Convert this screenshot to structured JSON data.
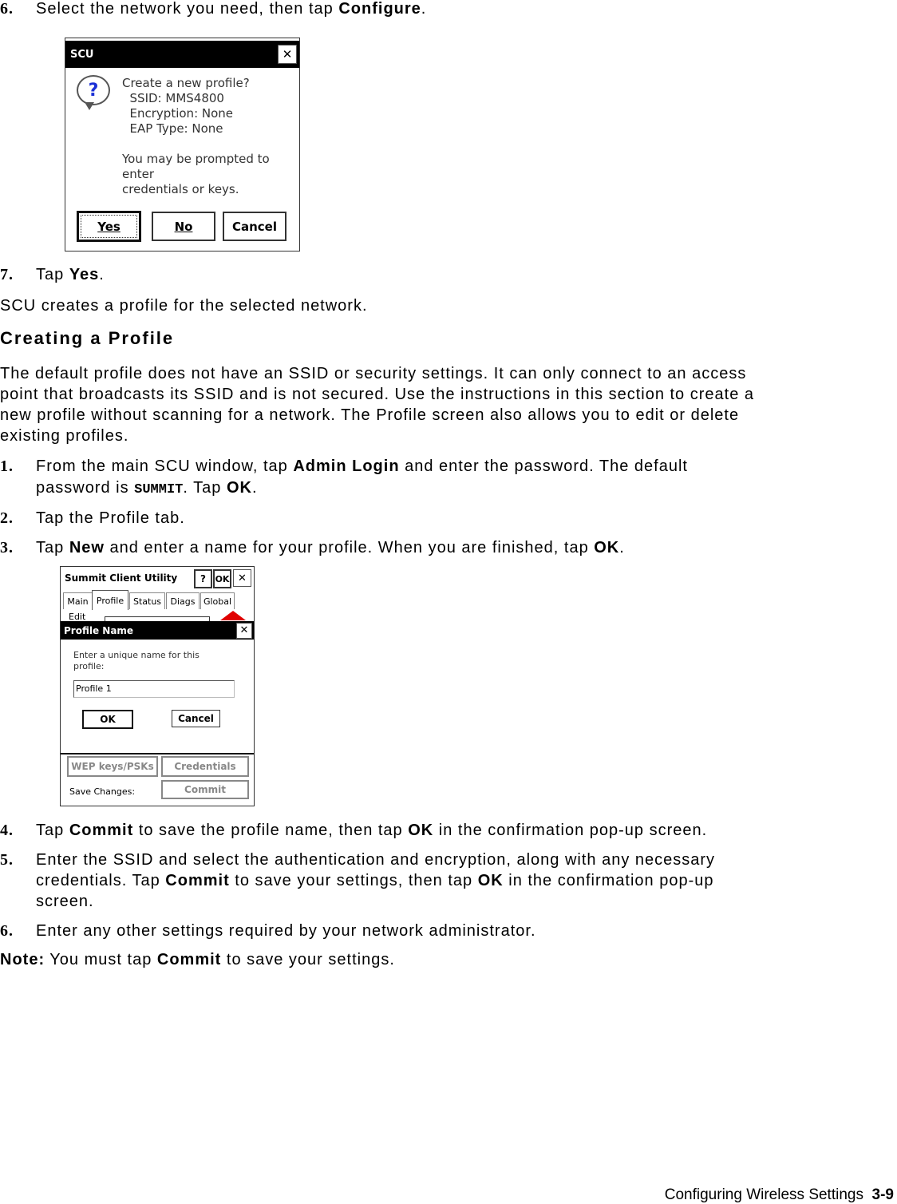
{
  "steps_top": [
    {
      "num": "6.",
      "pre": "Select the network you need, then tap ",
      "bold": "Configure",
      "post": "."
    },
    {
      "num": "7.",
      "pre": "Tap ",
      "bold": "Yes",
      "post": "."
    }
  ],
  "scu_dialog": {
    "title": "SCU",
    "close_glyph": "✕",
    "question_glyph": "?",
    "lines": [
      "Create a new profile?",
      "  SSID: MMS4800",
      "  Encryption: None",
      "  EAP Type: None",
      "",
      "You may be prompted to",
      "enter",
      "credentials or keys."
    ],
    "buttons": {
      "yes": "Yes",
      "no": "No",
      "cancel": "Cancel"
    }
  },
  "para_created": "SCU creates a profile for the selected network.",
  "heading": "Creating a Profile",
  "intro_lines": [
    "The default profile does not have an SSID or security settings. It can only connect to an access",
    "point that broadcasts its SSID and is not secured. Use the instructions in this section to create a",
    "new profile without scanning for a network. The Profile screen also allows you to edit or delete",
    "existing profiles."
  ],
  "steps": {
    "s1": {
      "num": "1.",
      "a": "From the main SCU window, tap ",
      "b": "Admin Login",
      "c": " and enter the password.  The default",
      "d": "password is ",
      "mono": "SUMMIT",
      "e": ". Tap ",
      "f": "OK",
      "g": "."
    },
    "s2": {
      "num": "2.",
      "text": "Tap the Profile tab."
    },
    "s3": {
      "num": "3.",
      "a": "Tap ",
      "b": "New",
      "c": " and enter a name for your profile. When you are finished, tap ",
      "d": "OK",
      "e": "."
    },
    "s4": {
      "num": "4.",
      "a": "Tap ",
      "b": "Commit",
      "c": " to save the profile name, then tap ",
      "d": "OK",
      "e": " in the confirmation pop-up screen."
    },
    "s5": {
      "num": "5.",
      "a": "Enter the SSID and select the authentication and encryption, along with any necessary",
      "b": "credentials. Tap ",
      "c": "Commit",
      "d": " to save your settings, then tap ",
      "e": "OK",
      "f": " in the confirmation pop-up",
      "g": "screen."
    },
    "s6": {
      "num": "6.",
      "text": "Enter any other settings required by your network administrator."
    }
  },
  "note": {
    "label": "Note:",
    "a": " You must tap ",
    "b": "Commit",
    "c": " to save your settings."
  },
  "scu_app": {
    "title": "Summit Client Utility",
    "help": "?",
    "ok": "OK",
    "close": "✕",
    "tabs": [
      "Main",
      "Profile",
      "Status",
      "Diags",
      "Global"
    ],
    "edit_label": "Edit",
    "profile_dialog": {
      "title": "Profile Name",
      "prompt_lines": [
        "Enter a unique name for this",
        "profile:"
      ],
      "value": "Profile 1",
      "ok": "OK",
      "cancel": "Cancel"
    },
    "wep_button": "WEP keys/PSKs",
    "credentials_button": "Credentials",
    "save_label": "Save Changes:",
    "commit_button": "Commit"
  },
  "footer": {
    "section": "Configuring Wireless Settings",
    "page": "3-9"
  }
}
